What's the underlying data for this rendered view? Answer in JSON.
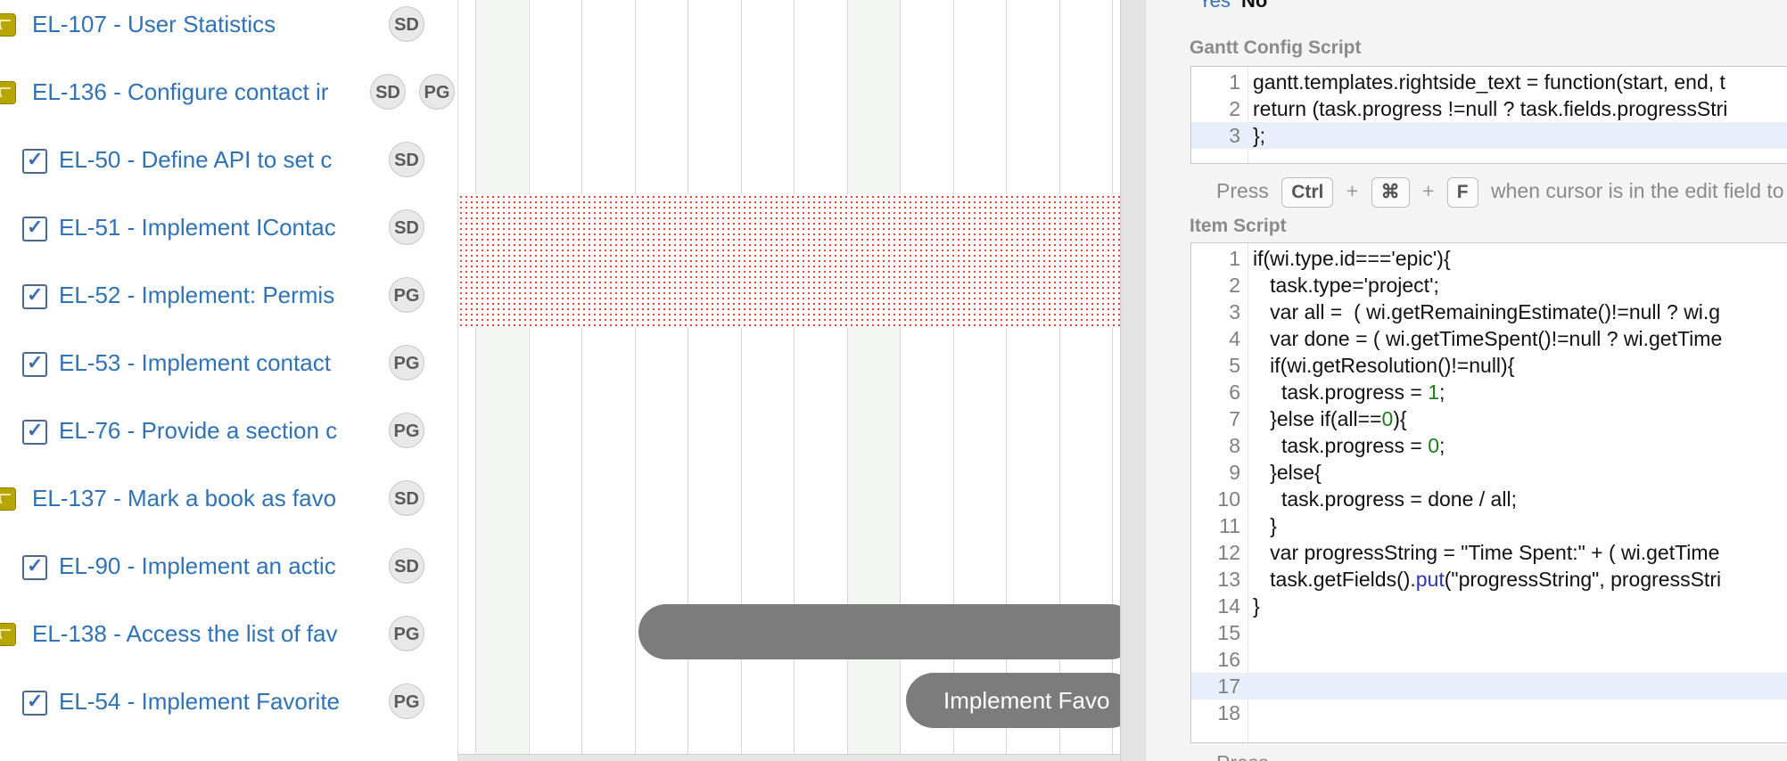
{
  "task_rows": [
    {
      "type": "epic",
      "key_title": "EL-107 - User Statistics",
      "avatars": [
        "SD"
      ]
    },
    {
      "type": "epic",
      "key_title": "EL-136 - Configure contact ir",
      "avatars": [
        "SD",
        "PG"
      ]
    },
    {
      "type": "task",
      "key_title": "EL-50 - Define API to set c",
      "avatars": [
        "SD"
      ]
    },
    {
      "type": "task",
      "key_title": "EL-51 - Implement IContac",
      "avatars": [
        "SD"
      ]
    },
    {
      "type": "task",
      "key_title": "EL-52 - Implement: Permis",
      "avatars": [
        "PG"
      ]
    },
    {
      "type": "task",
      "key_title": "EL-53 - Implement contact",
      "avatars": [
        "PG"
      ]
    },
    {
      "type": "task",
      "key_title": "EL-76 - Provide a section c",
      "avatars": [
        "PG"
      ]
    },
    {
      "type": "epic",
      "key_title": "EL-137 - Mark a book as favo",
      "avatars": [
        "SD"
      ]
    },
    {
      "type": "task",
      "key_title": "EL-90 - Implement an actic",
      "avatars": [
        "SD"
      ]
    },
    {
      "type": "epic",
      "key_title": "EL-138 - Access the list of fav",
      "avatars": [
        "PG"
      ]
    },
    {
      "type": "task",
      "key_title": "EL-54 - Implement Favorite",
      "avatars": [
        "PG"
      ]
    }
  ],
  "gantt": {
    "bar_label": "Implement Favo"
  },
  "panel": {
    "top_field_label": "Yes",
    "top_field_value": "No",
    "gantt_config_label": "Gantt Config Script",
    "gantt_config_lines": [
      "gantt.templates.rightside_text = function(start, end, t",
      "return (task.progress !=null ? task.fields.progressStri",
      "};"
    ],
    "hint_press": "Press",
    "hint_ctrl": "Ctrl",
    "hint_plus": "+",
    "hint_cmd": "⌘",
    "hint_f": "F",
    "hint_rest": "when cursor is in the edit field to t",
    "item_script_label": "Item Script",
    "item_script_lines": [
      "if(wi.type.id==='epic'){",
      "   task.type='project';",
      "   var all =  ( wi.getRemainingEstimate()!=null ? wi.g",
      "   var done = ( wi.getTimeSpent()!=null ? wi.getTime",
      "   if(wi.getResolution()!=null){",
      "     task.progress = 1;",
      "   }else if(all==0){",
      "     task.progress = 0;",
      "   }else{",
      "     task.progress = done / all;",
      "   }",
      "   var progressString = \"Time Spent:\" + ( wi.getTime",
      "   task.getFields().put(\"progressString\", progressStri",
      "}",
      "",
      "",
      "",
      ""
    ],
    "bottom_hint_press": "Press"
  }
}
